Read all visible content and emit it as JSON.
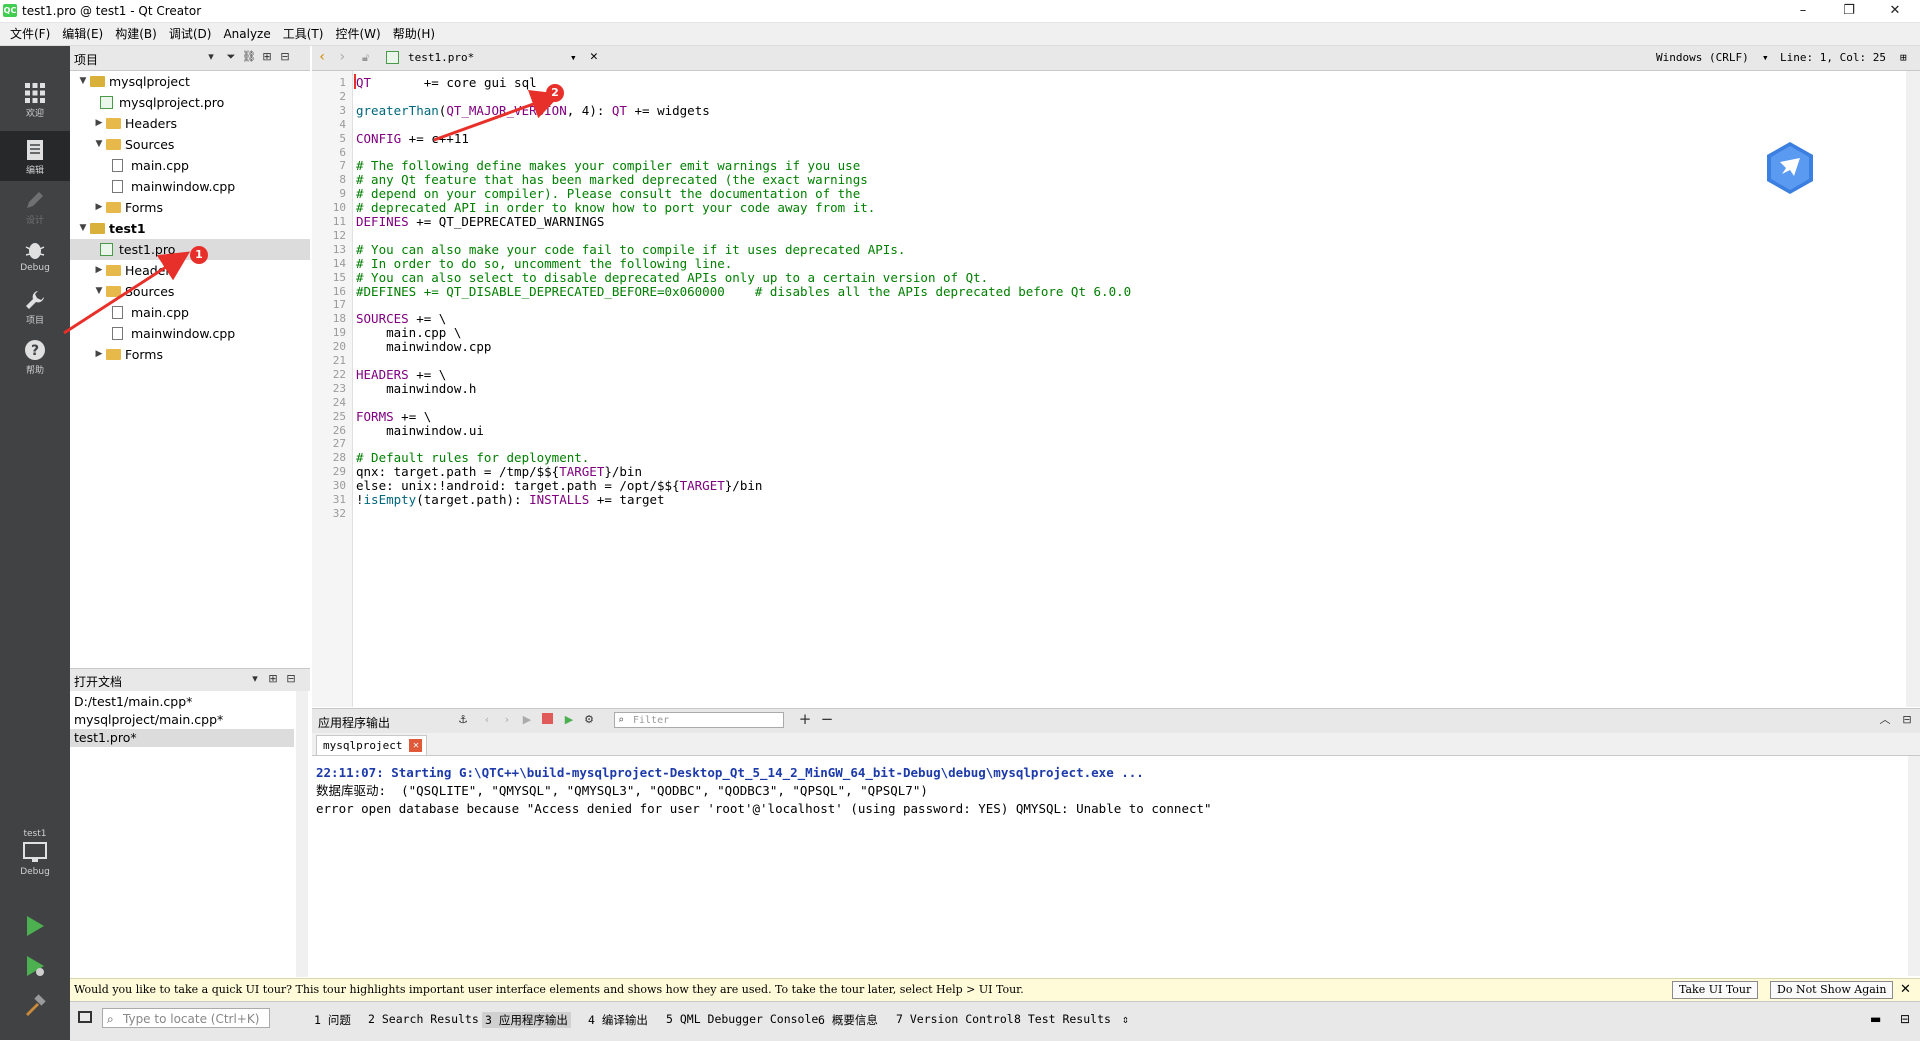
{
  "window": {
    "title": "test1.pro @ test1 - Qt Creator",
    "logo": "QC"
  },
  "menu": [
    "文件(F)",
    "编辑(E)",
    "构建(B)",
    "调试(D)",
    "Analyze",
    "工具(T)",
    "控件(W)",
    "帮助(H)"
  ],
  "modes": [
    {
      "label": "欢迎",
      "icon": "grid-icon"
    },
    {
      "label": "编辑",
      "icon": "document-icon"
    },
    {
      "label": "设计",
      "icon": "pencil-icon"
    },
    {
      "label": "Debug",
      "icon": "bug-icon"
    },
    {
      "label": "项目",
      "icon": "wrench-icon"
    },
    {
      "label": "帮助",
      "icon": "help-icon"
    }
  ],
  "kit": {
    "project": "test1",
    "config": "Debug"
  },
  "projects_panel": {
    "title": "项目",
    "tree": [
      {
        "label": "mysqlproject",
        "kind": "project",
        "arrow": "down",
        "depth": 0
      },
      {
        "label": "mysqlproject.pro",
        "kind": "pro",
        "arrow": "",
        "depth": 1
      },
      {
        "label": "Headers",
        "kind": "folder",
        "arrow": "right",
        "depth": 1
      },
      {
        "label": "Sources",
        "kind": "folder",
        "arrow": "down",
        "depth": 1
      },
      {
        "label": "main.cpp",
        "kind": "file",
        "arrow": "",
        "depth": 2
      },
      {
        "label": "mainwindow.cpp",
        "kind": "file",
        "arrow": "",
        "depth": 2
      },
      {
        "label": "Forms",
        "kind": "folder",
        "arrow": "right",
        "depth": 1
      },
      {
        "label": "test1",
        "kind": "project-bold",
        "arrow": "down",
        "depth": 0
      },
      {
        "label": "test1.pro",
        "kind": "pro",
        "arrow": "",
        "depth": 1,
        "selected": true
      },
      {
        "label": "Headers",
        "kind": "folder",
        "arrow": "right",
        "depth": 1
      },
      {
        "label": "Sources",
        "kind": "folder",
        "arrow": "down",
        "depth": 1
      },
      {
        "label": "main.cpp",
        "kind": "file",
        "arrow": "",
        "depth": 2
      },
      {
        "label": "mainwindow.cpp",
        "kind": "file",
        "arrow": "",
        "depth": 2
      },
      {
        "label": "Forms",
        "kind": "folder",
        "arrow": "right",
        "depth": 1
      }
    ]
  },
  "open_docs": {
    "title": "打开文档",
    "items": [
      "D:/test1/main.cpp*",
      "mysqlproject/main.cpp*",
      "test1.pro*"
    ],
    "selected_index": 2
  },
  "editor_toolbar": {
    "file": "test1.pro*",
    "line_ending": "Windows (CRLF)",
    "position": "Line: 1, Col: 25"
  },
  "editor": {
    "lines": [
      [
        [
          "kw",
          "QT"
        ],
        [
          "",
          "       += core gui sql"
        ]
      ],
      [],
      [
        [
          "fn",
          "greaterThan"
        ],
        [
          "",
          "("
        ],
        [
          "kw",
          "QT_MAJOR_VERSION"
        ],
        [
          "",
          ", 4): "
        ],
        [
          "kw",
          "QT"
        ],
        [
          "",
          " += widgets"
        ]
      ],
      [],
      [
        [
          "kw",
          "CONFIG"
        ],
        [
          "",
          " += c++11"
        ]
      ],
      [],
      [
        [
          "cm",
          "# The following define makes your compiler emit warnings if you use"
        ]
      ],
      [
        [
          "cm",
          "# any Qt feature that has been marked deprecated (the exact warnings"
        ]
      ],
      [
        [
          "cm",
          "# depend on your compiler). Please consult the documentation of the"
        ]
      ],
      [
        [
          "cm",
          "# deprecated API in order to know how to port your code away from it."
        ]
      ],
      [
        [
          "kw",
          "DEFINES"
        ],
        [
          "",
          " += QT_DEPRECATED_WARNINGS"
        ]
      ],
      [],
      [
        [
          "cm",
          "# You can also make your code fail to compile if it uses deprecated APIs."
        ]
      ],
      [
        [
          "cm",
          "# In order to do so, uncomment the following line."
        ]
      ],
      [
        [
          "cm",
          "# You can also select to disable deprecated APIs only up to a certain version of Qt."
        ]
      ],
      [
        [
          "cm",
          "#DEFINES += QT_DISABLE_DEPRECATED_BEFORE=0x060000    # disables all the APIs deprecated before Qt 6.0.0"
        ]
      ],
      [],
      [
        [
          "kw",
          "SOURCES"
        ],
        [
          "",
          " += \\"
        ]
      ],
      [
        [
          "",
          "    main.cpp \\"
        ]
      ],
      [
        [
          "",
          "    mainwindow.cpp"
        ]
      ],
      [],
      [
        [
          "kw",
          "HEADERS"
        ],
        [
          "",
          " += \\"
        ]
      ],
      [
        [
          "",
          "    mainwindow.h"
        ]
      ],
      [],
      [
        [
          "kw",
          "FORMS"
        ],
        [
          "",
          " += \\"
        ]
      ],
      [
        [
          "",
          "    mainwindow.ui"
        ]
      ],
      [],
      [
        [
          "cm",
          "# Default rules for deployment."
        ]
      ],
      [
        [
          "",
          "qnx: target.path = /tmp/$${"
        ],
        [
          "kw",
          "TARGET"
        ],
        [
          "",
          "}/bin"
        ]
      ],
      [
        [
          "",
          "else: unix:!android: target.path = /opt/$${"
        ],
        [
          "kw",
          "TARGET"
        ],
        [
          "",
          "}/bin"
        ]
      ],
      [
        [
          "",
          "!"
        ],
        [
          "fn",
          "isEmpty"
        ],
        [
          "",
          "(target.path): "
        ],
        [
          "kw",
          "INSTALLS"
        ],
        [
          "",
          " += target"
        ]
      ],
      []
    ]
  },
  "output_pane": {
    "title": "应用程序输出",
    "filter_placeholder": "Filter",
    "tab": "mysqlproject",
    "lines": [
      {
        "text": "22:11:07: Starting G:\\QTC++\\build-mysqlproject-Desktop_Qt_5_14_2_MinGW_64_bit-Debug\\debug\\mysqlproject.exe ...",
        "color": "#1c3aa9",
        "bold": true
      },
      {
        "text": "数据库驱动:  (\"QSQLITE\", \"QMYSQL\", \"QMYSQL3\", \"QODBC\", \"QODBC3\", \"QPSQL\", \"QPSQL7\")",
        "color": "#000000",
        "bold": false
      },
      {
        "text": "error open database because \"Access denied for user 'root'@'localhost' (using password: YES) QMYSQL: Unable to connect\"",
        "color": "#000000",
        "bold": false
      }
    ]
  },
  "tour": {
    "message": "Would you like to take a quick UI tour? This tour highlights important user interface elements and shows how they are used. To take the tour later, select Help > UI Tour.",
    "take_label": "Take UI Tour",
    "dismiss_label": "Do Not Show Again"
  },
  "statusbar": {
    "locate_placeholder": "Type to locate (Ctrl+K)",
    "tabs": [
      "1 问题",
      "2 Search Results",
      "3 应用程序输出",
      "4 编译输出",
      "5 QML Debugger Console",
      "6 概要信息",
      "7 Version Control",
      "8 Test Results"
    ],
    "active_index": 2
  },
  "annotations": [
    "1",
    "2"
  ],
  "colors": {
    "mode_bar": "#404244",
    "accent_arrow": "#e8302a",
    "keyword": "#800080",
    "comment": "#008000"
  }
}
